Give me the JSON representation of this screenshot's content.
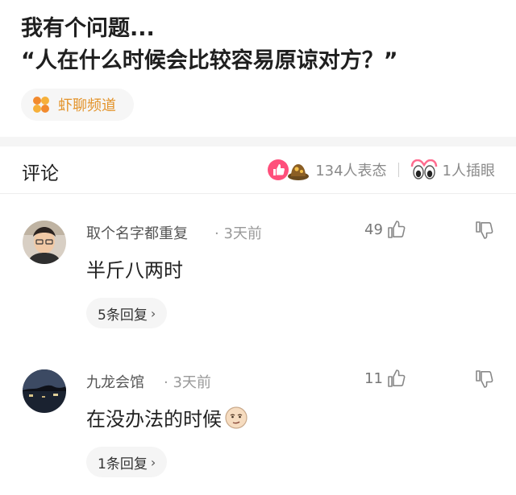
{
  "post": {
    "title_line1": "我有个问题...",
    "title_line2": "“人在什么时候会比较容易原谅对方？”",
    "channel": "虾聊频道",
    "channel_color": "#e3932a"
  },
  "comments_bar": {
    "title": "评论",
    "reaction_text": "134人表态",
    "eye_text": "1人插眼"
  },
  "comments": [
    {
      "name": "取个名字都重复",
      "time": "· 3天前",
      "likes": "49",
      "text": "半斤八两时",
      "replies": "5条回复"
    },
    {
      "name": "九龙会馆",
      "time": "· 3天前",
      "likes": "11",
      "text": "在没办法的时候",
      "replies": "1条回复"
    }
  ]
}
